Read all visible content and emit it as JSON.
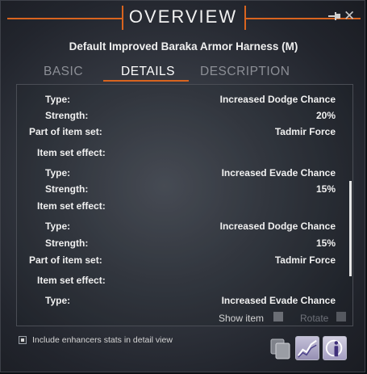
{
  "window": {
    "title": "OVERVIEW",
    "item_name": "Default Improved Baraka Armor Harness (M)",
    "pin_icon": "pin-icon",
    "close_icon": "close-icon",
    "close_glyph": "✕"
  },
  "tabs": [
    {
      "label": "BASIC",
      "active": false
    },
    {
      "label": "DETAILS",
      "active": true
    },
    {
      "label": "DESCRIPTION",
      "active": false
    }
  ],
  "details": [
    {
      "label": "Type:",
      "value": "Increased Dodge Chance"
    },
    {
      "label": "Strength:",
      "value": "20%"
    },
    {
      "label": "Part of item set:",
      "value": "Tadmir Force"
    },
    {
      "label": "Item set effect:",
      "value": ""
    },
    {
      "label": "Type:",
      "value": "Increased Evade Chance"
    },
    {
      "label": "Strength:",
      "value": "15%"
    },
    {
      "label": "Item set effect:",
      "value": ""
    },
    {
      "label": "Type:",
      "value": "Increased Dodge Chance"
    },
    {
      "label": "Strength:",
      "value": "15%"
    },
    {
      "label": "Part of item set:",
      "value": "Tadmir Force"
    },
    {
      "label": "Item set effect:",
      "value": ""
    },
    {
      "label": "Type:",
      "value": "Increased Evade Chance"
    }
  ],
  "options": {
    "show_item": "Show item",
    "rotate": "Rotate",
    "include_enhancers": "Include enhancers stats in detail view"
  },
  "colors": {
    "accent": "#d9641f",
    "text": "#f0f0f0",
    "muted": "#8c8f96"
  }
}
